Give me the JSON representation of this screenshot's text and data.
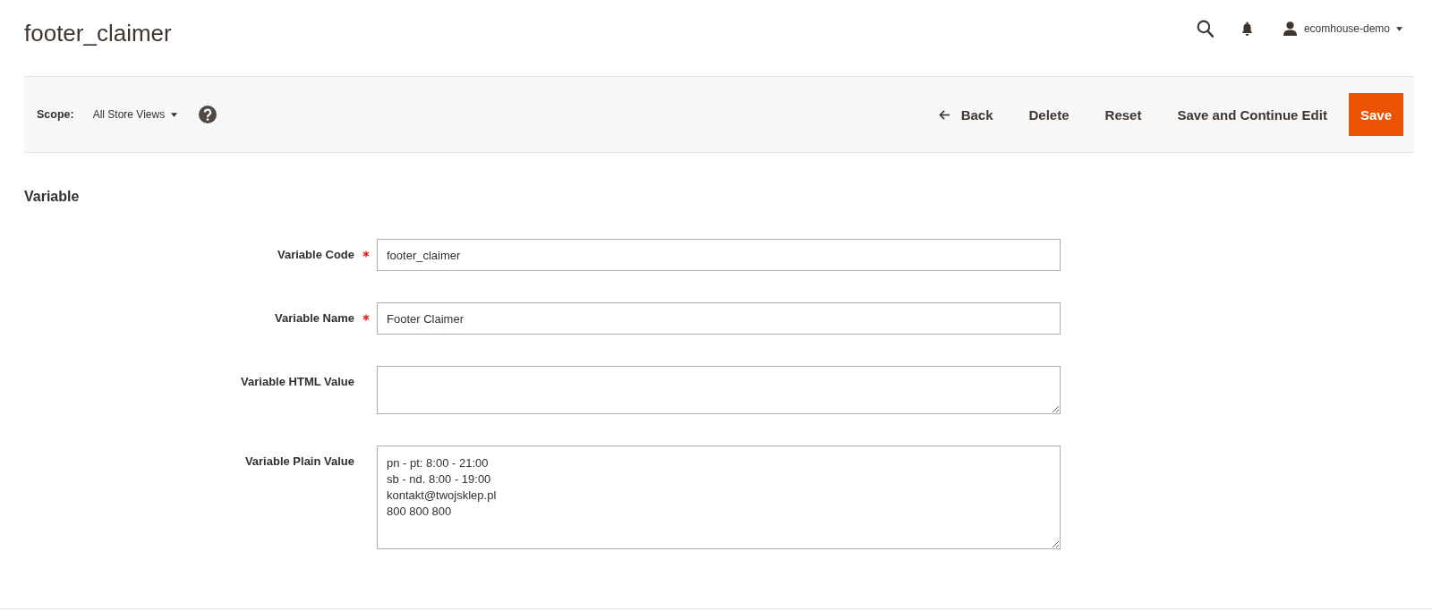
{
  "page": {
    "title": "footer_claimer"
  },
  "header": {
    "user": {
      "name": "ecomhouse-demo"
    }
  },
  "toolbar": {
    "scope": {
      "label": "Scope:",
      "value": "All Store Views"
    },
    "actions": [
      {
        "kind": "back",
        "label": "Back"
      },
      {
        "kind": "secondary",
        "label": "Delete"
      },
      {
        "kind": "secondary",
        "label": "Reset"
      },
      {
        "kind": "secondary",
        "label": "Save and Continue Edit"
      },
      {
        "kind": "primary",
        "label": "Save"
      }
    ]
  },
  "section": {
    "title": "Variable",
    "fields": [
      {
        "kind": "input",
        "label": "Variable Code",
        "required": true,
        "value": "footer_claimer"
      },
      {
        "kind": "input",
        "label": "Variable Name",
        "required": true,
        "value": "Footer Claimer"
      },
      {
        "kind": "textarea",
        "label": "Variable HTML Value",
        "required": false
      },
      {
        "kind": "textarea",
        "label": "Variable Plain Value",
        "required": false,
        "value": "pn - pt: 8:00 - 21:00\nsb - nd. 8:00 - 19:00\nkontakt@twojsklep.pl\n800 800 800"
      }
    ]
  }
}
